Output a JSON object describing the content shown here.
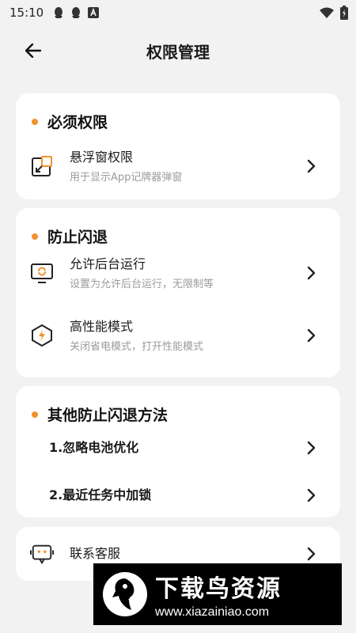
{
  "status_bar": {
    "time": "15:10",
    "left_icons": [
      "qq-icon",
      "qq-icon",
      "a-badge-icon"
    ],
    "right_icons": [
      "wifi-icon",
      "battery-icon"
    ]
  },
  "header": {
    "title": "权限管理",
    "back_icon": "arrow-left-icon"
  },
  "sections": {
    "required": {
      "title": "必须权限",
      "items": [
        {
          "label": "悬浮窗权限",
          "sub": "用于显示App记牌器弹窗",
          "icon": "floating-window-icon"
        }
      ]
    },
    "anti_exit": {
      "title": "防止闪退",
      "items": [
        {
          "label": "允许后台运行",
          "sub": "设置为允许后台运行，无限制等",
          "icon": "monitor-refresh-icon"
        },
        {
          "label": "高性能模式",
          "sub": "关闭省电模式，打开性能模式",
          "icon": "lightning-hex-icon"
        }
      ]
    },
    "other_methods": {
      "title": "其他防止闪退方法",
      "items": [
        {
          "label": "1.忽略电池优化"
        },
        {
          "label": "2.最近任务中加锁"
        }
      ]
    },
    "contact": {
      "items": [
        {
          "label": "联系客服",
          "icon": "chat-bubble-icon"
        }
      ]
    }
  },
  "watermark": {
    "main": "下载鸟资源",
    "url": "www.xiazainiao.com"
  },
  "colors": {
    "accent_dot": "#f0922f",
    "card_bg": "#ffffff",
    "page_bg": "#f2f2f2",
    "subtext": "#9b9b9b"
  }
}
